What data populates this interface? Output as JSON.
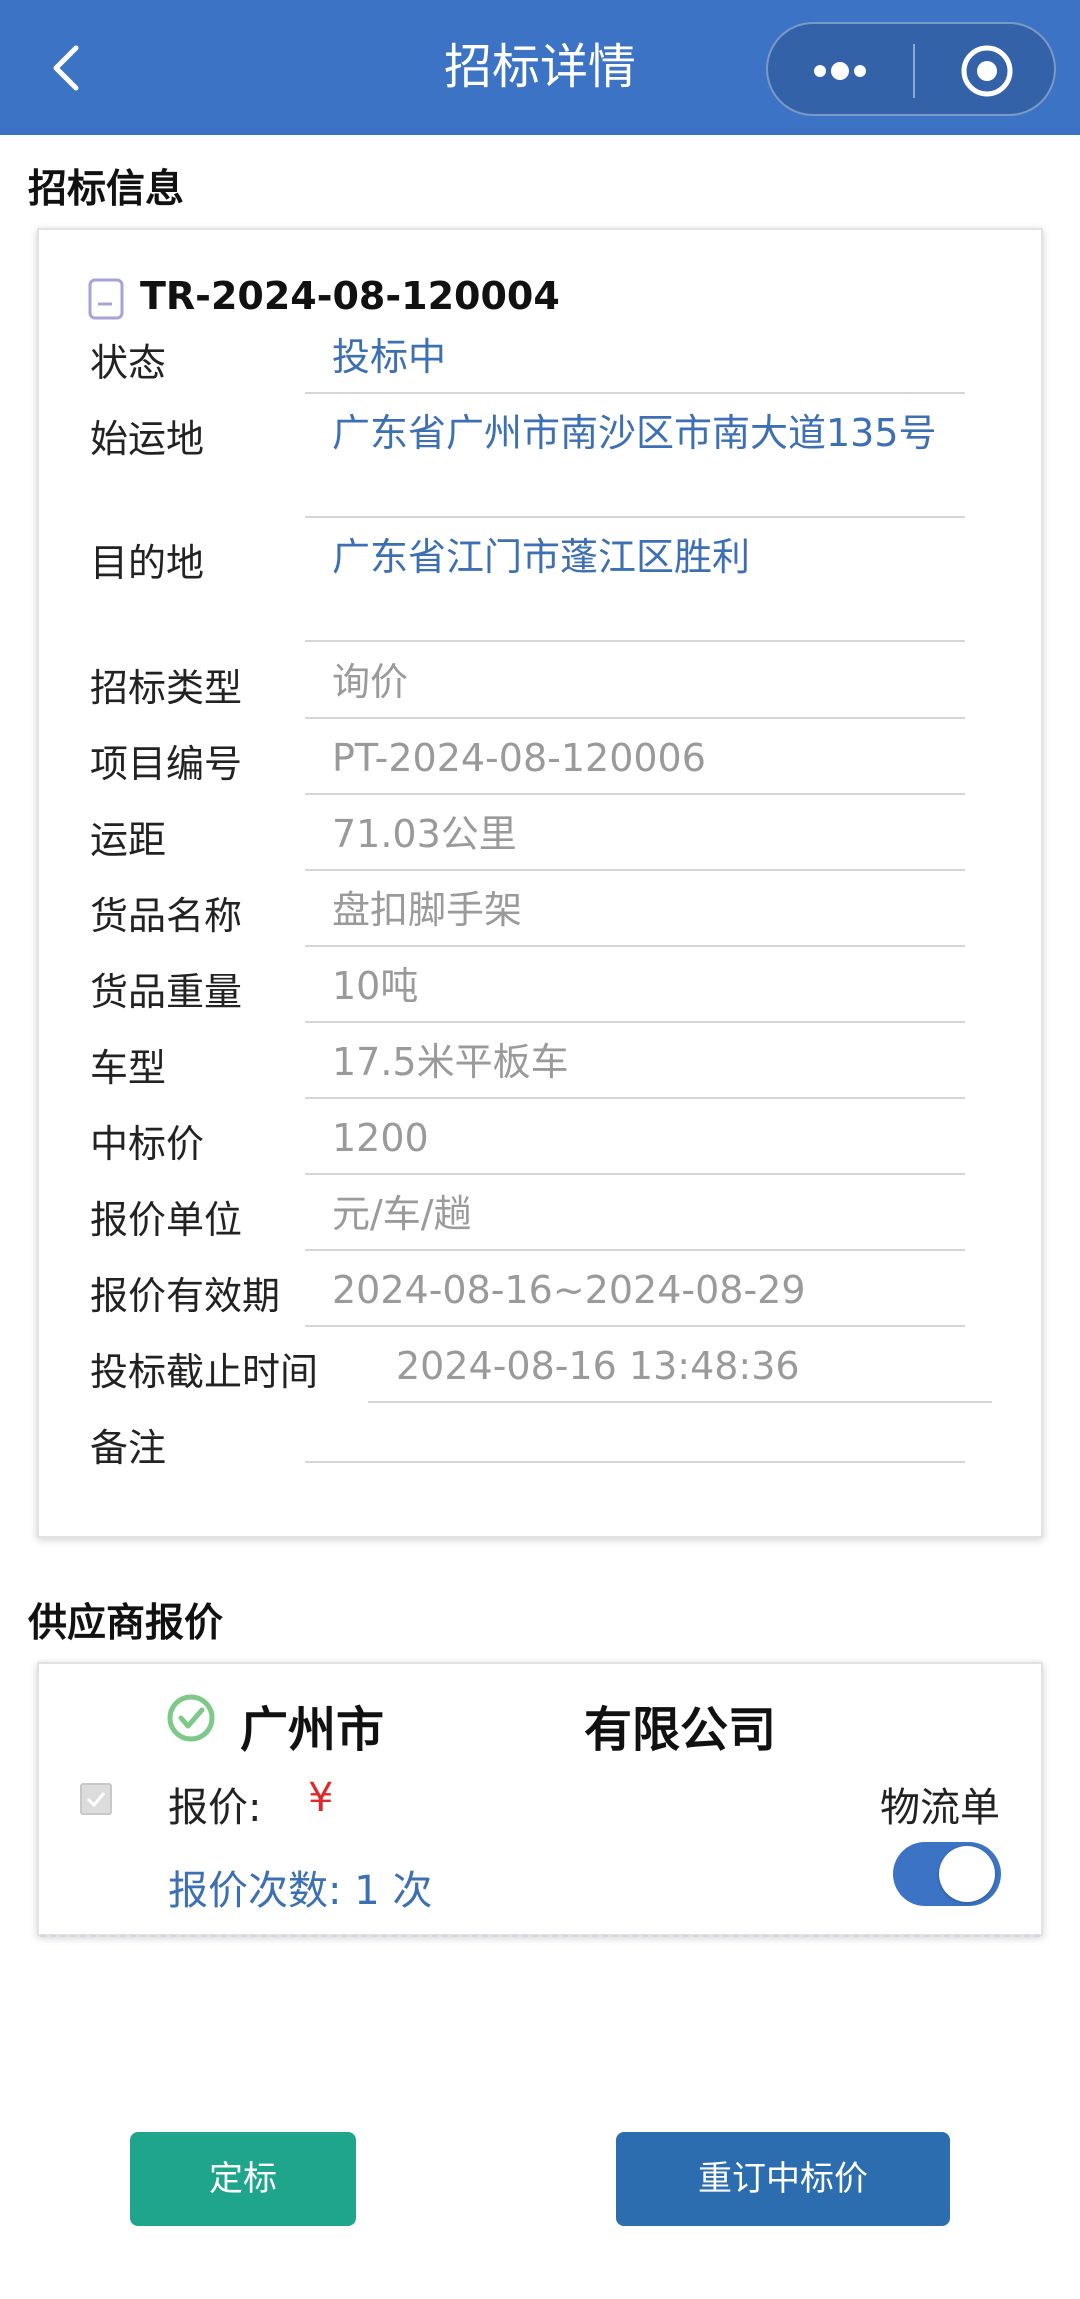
{
  "navbar": {
    "title": "招标详情",
    "back_icon": "chevron-left-icon",
    "more_icon": "more-dots-icon",
    "target_icon": "target-icon"
  },
  "tender_info": {
    "section_title": "招标信息",
    "code": "TR-2024-08-120004",
    "rows": [
      {
        "label": "状态",
        "value": "投标中",
        "style": "blue"
      },
      {
        "label": "始运地",
        "value": "广东省广州市南沙区市南大道135号",
        "style": "blue"
      },
      {
        "label": "目的地",
        "value": "广东省江门市蓬江区胜利",
        "style": "blue"
      },
      {
        "label": "招标类型",
        "value": "询价",
        "style": "gray"
      },
      {
        "label": "项目编号",
        "value": "PT-2024-08-120006",
        "style": "gray"
      },
      {
        "label": "运距",
        "value": "71.03公里",
        "style": "gray"
      },
      {
        "label": "货品名称",
        "value": "盘扣脚手架",
        "style": "gray"
      },
      {
        "label": "货品重量",
        "value": "10吨",
        "style": "gray"
      },
      {
        "label": "车型",
        "value": "17.5米平板车",
        "style": "gray"
      },
      {
        "label": "中标价",
        "value": "1200",
        "style": "gray"
      },
      {
        "label": "报价单位",
        "value": "元/车/趟",
        "style": "gray"
      },
      {
        "label": "报价有效期",
        "value": "2024-08-16~2024-08-29",
        "style": "gray"
      },
      {
        "label": "投标截止时间",
        "value": "2024-08-16 13:48:36",
        "style": "gray"
      },
      {
        "label": "备注",
        "value": "",
        "style": "gray"
      }
    ]
  },
  "supplier": {
    "section_title": "供应商报价",
    "company": "广州市",
    "company_suffix": "有限公司",
    "quote_label": "报价:",
    "quote_value": "¥ ",
    "logistics_label": "物流单",
    "count_label": "报价次数: 1 次",
    "logistics_toggle_on": true
  },
  "actions": {
    "award_label": "定标",
    "reset_price_label": "重订中标价"
  },
  "colors": {
    "navbar": "#3c73c5",
    "value_blue": "#3c6fb3",
    "quote_red": "#e0282a",
    "award_green": "#1fa58c",
    "reset_blue": "#2c6db0"
  }
}
